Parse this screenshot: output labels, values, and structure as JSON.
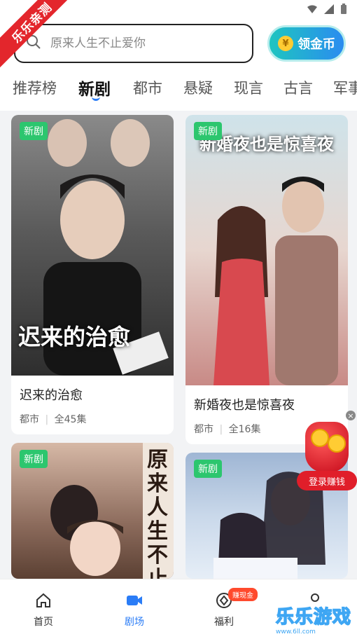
{
  "ribbon": "乐乐亲测",
  "search": {
    "placeholder": "原来人生不止爱你"
  },
  "coin_button": {
    "symbol": "¥",
    "label": "领金币"
  },
  "tabs": [
    "推荐榜",
    "新剧",
    "都市",
    "悬疑",
    "现言",
    "古言",
    "军事"
  ],
  "cards": [
    {
      "badge": "新剧",
      "poster_text": "迟来的治愈",
      "title": "迟来的治愈",
      "genre": "都市",
      "episodes": "全45集"
    },
    {
      "badge": "新剧",
      "poster_text": "新婚夜也是惊喜夜",
      "title": "新婚夜也是惊喜夜",
      "genre": "都市",
      "episodes": "全16集"
    },
    {
      "badge": "新剧",
      "poster_text": "原来人生不止爱"
    },
    {
      "badge": "新剧"
    }
  ],
  "promo": {
    "close": "×",
    "label": "登录赚钱"
  },
  "bottom_nav": [
    {
      "label": "首页",
      "icon": "home-icon"
    },
    {
      "label": "剧场",
      "icon": "video-icon"
    },
    {
      "label": "福利",
      "icon": "gift-icon",
      "badge": "赚现金"
    }
  ],
  "watermark": {
    "main": "乐乐游戏",
    "url": "www.6ll.com"
  },
  "colors": {
    "accent": "#2a7cf6",
    "badge_green": "#2cc66e",
    "ribbon_red": "#e3262c"
  }
}
